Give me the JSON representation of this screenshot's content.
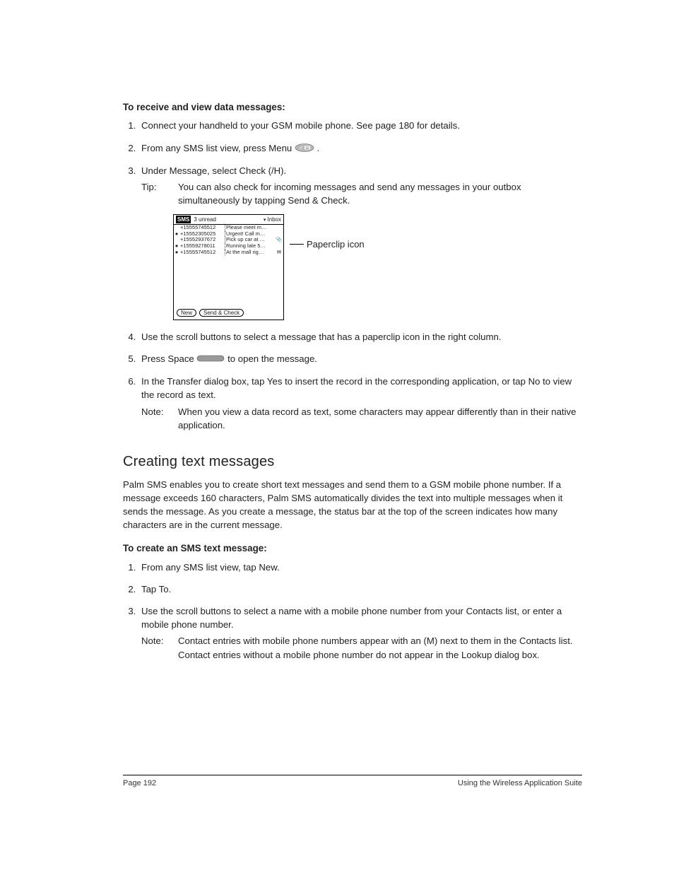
{
  "section1": {
    "title": "To receive and view data messages:",
    "step1": "Connect your handheld to your GSM mobile phone. See page 180 for details.",
    "step2_a": "From any SMS list view, press Menu ",
    "step2_b": ".",
    "step3": "Under Message, select Check (/H).",
    "tip_label": "Tip:",
    "tip_body": "You can also check for incoming messages and send any messages in your outbox simultaneously by tapping Send & Check.",
    "step4": "Use the scroll buttons to select a message that has a paperclip icon in the right column.",
    "step5_a": "Press Space ",
    "step5_b": " to open the message.",
    "step6": "In the Transfer dialog box, tap Yes to insert the record in the corresponding application, or tap No to view the record as text.",
    "note_label": "Note:",
    "note_body": "When you view a data record as text, some characters may appear differently than in their native application."
  },
  "screenshot": {
    "app_title": "SMS",
    "unread": "3 unread",
    "folder": "Inbox",
    "rows": [
      {
        "dot": "",
        "phone": "+15555745512",
        "msg": "Please meet m…",
        "icon": ""
      },
      {
        "dot": "●",
        "phone": "+15552305025",
        "msg": "Urgent! Call m…",
        "icon": ""
      },
      {
        "dot": "",
        "phone": "+15552937672",
        "msg": "Pick up car at …",
        "icon": "📎"
      },
      {
        "dot": "●",
        "phone": "+15559278011",
        "msg": "Running late 5…",
        "icon": ""
      },
      {
        "dot": "●",
        "phone": "+15555745512",
        "msg": "At the mall rig…",
        "icon": "✉"
      }
    ],
    "btn_new": "New",
    "btn_send": "Send & Check",
    "callout": "Paperclip icon"
  },
  "section2": {
    "heading": "Creating text messages",
    "intro": "Palm SMS enables you to create short text messages and send them to a GSM mobile phone number. If a message exceeds 160 characters, Palm SMS automatically divides the text into multiple messages when it sends the message. As you create a message, the status bar at the top of the screen indicates how many characters are in the current message.",
    "subtitle": "To create an SMS text message:",
    "step1": "From any SMS list view, tap New.",
    "step2": "Tap To.",
    "step3": "Use the scroll buttons to select a name with a mobile phone number from your Contacts list, or enter a mobile phone number.",
    "note_label": "Note:",
    "note_body": "Contact entries with mobile phone numbers appear with an (M) next to them in the Contacts list. Contact entries without a mobile phone number do not appear in the Lookup dialog box."
  },
  "footer": {
    "left": "Page 192",
    "right": "Using the Wireless Application Suite"
  }
}
